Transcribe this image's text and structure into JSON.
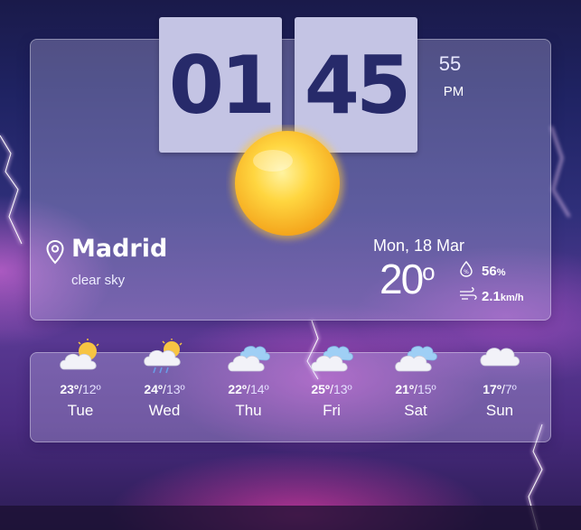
{
  "clock": {
    "hours": "01",
    "minutes": "45",
    "seconds": "55",
    "period": "PM"
  },
  "location": {
    "city": "Madrid",
    "condition": "clear sky",
    "icon": "location-pin-icon"
  },
  "current": {
    "date": "Mon, 18 Mar",
    "temperature": "20",
    "temperature_unit": "o",
    "humidity_value": "56",
    "humidity_unit": "%",
    "wind_value": "2.1",
    "wind_unit": "km/h",
    "weather_icon": "sun-icon"
  },
  "forecast": [
    {
      "day": "Tue",
      "high": "23º",
      "low": "12º",
      "icon": "partly-cloudy-icon"
    },
    {
      "day": "Wed",
      "high": "24º",
      "low": "13º",
      "icon": "sun-rain-cloud-icon"
    },
    {
      "day": "Thu",
      "high": "22º",
      "low": "14º",
      "icon": "clouds-icon"
    },
    {
      "day": "Fri",
      "high": "25º",
      "low": "13º",
      "icon": "clouds-icon"
    },
    {
      "day": "Sat",
      "high": "21º",
      "low": "15º",
      "icon": "clouds-icon"
    },
    {
      "day": "Sun",
      "high": "17º",
      "low": "7º",
      "icon": "cloud-icon"
    }
  ],
  "colors": {
    "clock_text": "#272a6a",
    "clock_card": "#c4c4e4",
    "sun": "#ffcc33"
  }
}
